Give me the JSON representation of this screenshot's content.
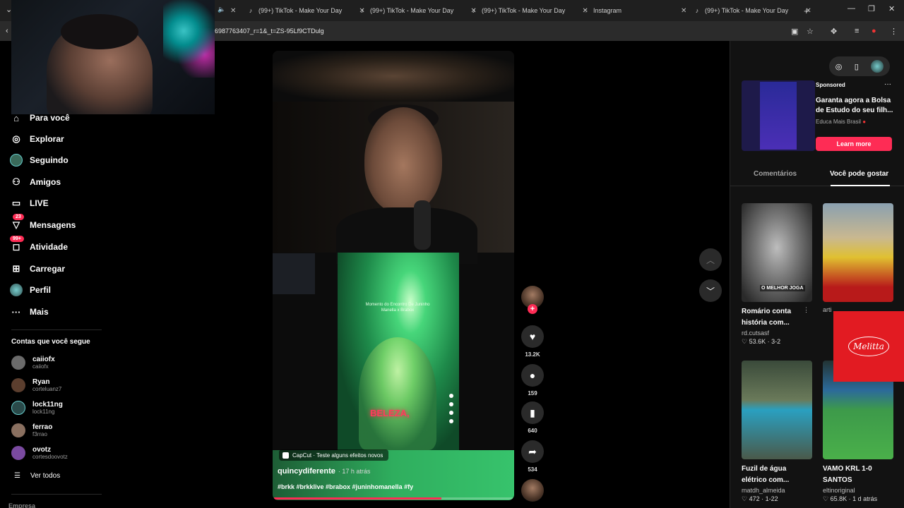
{
  "browser": {
    "tabs": [
      {
        "label": "(99+) TikTok - Make Your Day",
        "icon": "tiktok-icon"
      },
      {
        "label": "(99+) TikTok - Make Your Day",
        "icon": "tiktok-icon"
      },
      {
        "label": "(99+) TikTok - Make Your Day",
        "icon": "tiktok-icon"
      },
      {
        "label": "Instagram",
        "icon": "instagram-icon"
      },
      {
        "label": "(99+) TikTok - Make Your Day",
        "icon": "tiktok-icon"
      }
    ],
    "new_tab": "+",
    "url": "6987763407_r=1&_t=ZS-95Lf9CTDulg"
  },
  "sidebar": {
    "items": [
      {
        "label": "Para você",
        "icon": "home-icon"
      },
      {
        "label": "Explorar",
        "icon": "compass-icon"
      },
      {
        "label": "Seguindo",
        "icon": "following-icon"
      },
      {
        "label": "Amigos",
        "icon": "friends-icon"
      },
      {
        "label": "LIVE",
        "icon": "live-icon"
      },
      {
        "label": "Mensagens",
        "icon": "messages-icon",
        "badge": "23"
      },
      {
        "label": "Atividade",
        "icon": "activity-icon",
        "badge": "99+"
      },
      {
        "label": "Carregar",
        "icon": "upload-icon"
      },
      {
        "label": "Perfil",
        "icon": "profile-icon"
      },
      {
        "label": "Mais",
        "icon": "more-icon"
      }
    ],
    "following_title": "Contas que você segue",
    "following": [
      {
        "name": "caiiofx",
        "handle": "caiiofx",
        "color": "#6b6b6b"
      },
      {
        "name": "Ryan",
        "handle": "corteluanz7",
        "color": "#5b3e2e"
      },
      {
        "name": "lock11ng",
        "handle": "lock11ng",
        "color": "#2a8a8a"
      },
      {
        "name": "ferrao",
        "handle": "f3rrao",
        "color": "#8a7060"
      },
      {
        "name": "ovotz",
        "handle": "cortesdoovotz",
        "color": "#7a4aa0"
      }
    ],
    "see_all": "Ver todos",
    "company": "Empresa"
  },
  "video": {
    "overlay_caption": "Momento do Encontro De Juninho Manella x Brabox",
    "burned_text": "BELEZA,",
    "capcut": "CapCut · Teste alguns efeitos novos",
    "author": "quincydiferente",
    "time": "· 17 h atrás",
    "hashtags": "#brkk #brkklive #brabox #juninhomanella #fy",
    "progress": 0.7
  },
  "actions": {
    "likes": "13.2K",
    "comments": "159",
    "saves": "640",
    "shares": "534"
  },
  "right": {
    "ad": {
      "sponsored": "Sponsored",
      "title": "Garanta agora a Bolsa de Estudo do seu filh...",
      "brand": "Educa Mais Brasil",
      "cta": "Learn more"
    },
    "tabs": {
      "comments": "Comentários",
      "suggested": "Você pode gostar"
    },
    "cards": [
      {
        "title": "Romário conta história com...",
        "account": "rd.cutsasf",
        "stats": "♡ 53.6K · 3-2",
        "overlay": "O MELHOR JOGA"
      },
      {
        "title": "",
        "account": "arti",
        "stats": "",
        "overlay": ""
      },
      {
        "title": "Fuzil de água elétrico com...",
        "account": "matdh_almeida",
        "stats": "♡ 472 · 1-22",
        "overlay": ""
      },
      {
        "title": "VAMO KRL 1-0 SANTOS",
        "account": "eltinoriginal",
        "stats": "♡ 65.8K · 1 d atrás",
        "overlay": ""
      }
    ]
  },
  "ad_overlay": {
    "brand": "Melitta",
    "color": "#e21b22"
  },
  "colors": {
    "accent": "#fe2c55",
    "background": "#000000"
  }
}
